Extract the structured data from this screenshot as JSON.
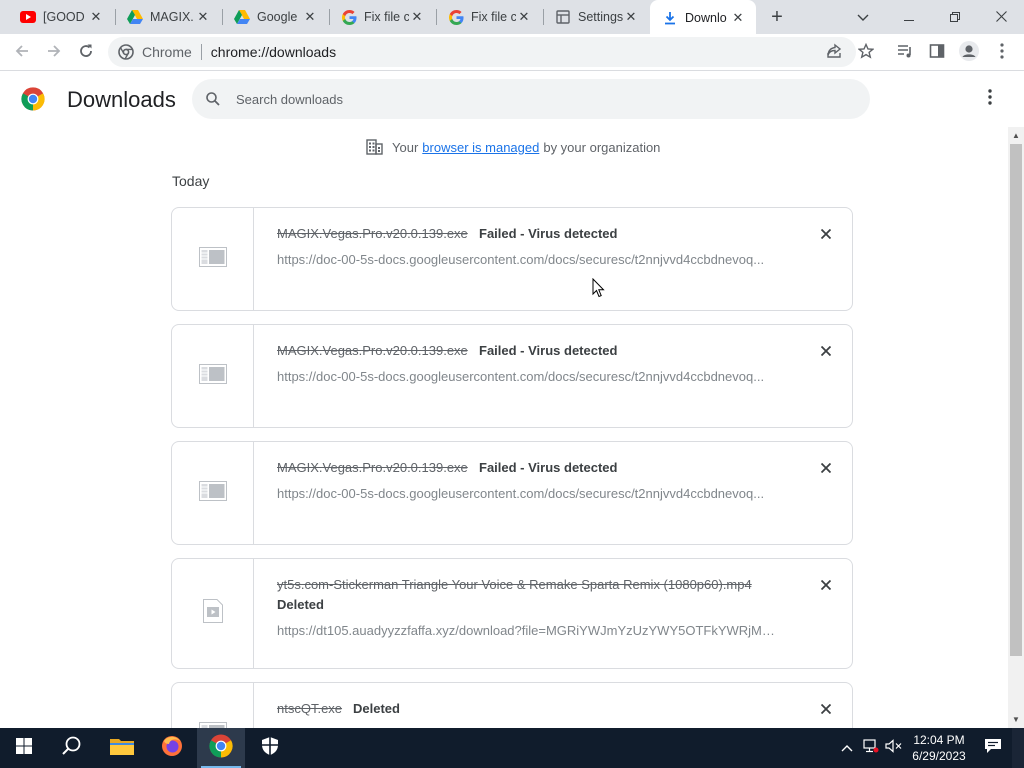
{
  "tabs": [
    {
      "title": "[GOOD",
      "favicon": "youtube-icon",
      "active": false
    },
    {
      "title": "MAGIX.",
      "favicon": "google-drive-icon",
      "active": false
    },
    {
      "title": "Google",
      "favicon": "google-drive-icon",
      "active": false
    },
    {
      "title": "Fix file c",
      "favicon": "google-icon",
      "active": false
    },
    {
      "title": "Fix file c",
      "favicon": "google-icon",
      "active": false
    },
    {
      "title": "Settings",
      "favicon": "settings-icon",
      "active": false
    },
    {
      "title": "Downlo",
      "favicon": "download-icon",
      "active": true
    }
  ],
  "toolbar": {
    "site_label": "Chrome",
    "url": "chrome://downloads"
  },
  "page": {
    "title": "Downloads",
    "search_placeholder": "Search downloads",
    "managed_prefix": "Your",
    "managed_link": "browser is managed",
    "managed_suffix": "by your organization",
    "section": "Today"
  },
  "downloads": [
    {
      "filename": "MAGIX.Vegas.Pro.v20.0.139.exe",
      "status": "Failed - Virus detected",
      "source": "https://doc-00-5s-docs.googleusercontent.com/docs/securesc/t2nnjvvd4ccbdnevoq...",
      "icon": "file-icon"
    },
    {
      "filename": "MAGIX.Vegas.Pro.v20.0.139.exe",
      "status": "Failed - Virus detected",
      "source": "https://doc-00-5s-docs.googleusercontent.com/docs/securesc/t2nnjvvd4ccbdnevoq...",
      "icon": "file-icon"
    },
    {
      "filename": "MAGIX.Vegas.Pro.v20.0.139.exe",
      "status": "Failed - Virus detected",
      "source": "https://doc-00-5s-docs.googleusercontent.com/docs/securesc/t2nnjvvd4ccbdnevoq...",
      "icon": "file-icon"
    },
    {
      "filename": "yt5s.com-Stickerman Triangle Your Voice & Remake Sparta Remix (1080p60).mp4",
      "status": "Deleted",
      "source": "https://dt105.auadyyzzfaffa.xyz/download?file=MGRiYWJmYzUzYWY5OTFkYWRjMjI...",
      "icon": "video-file-icon"
    },
    {
      "filename": "ntscQT.exe",
      "status": "Deleted",
      "source": "",
      "icon": "file-icon"
    }
  ],
  "taskbar": {
    "time": "12:04 PM",
    "date": "6/29/2023"
  },
  "colors": {
    "tabstrip": "#dee1e6",
    "accent_link": "#1a73e8",
    "taskbar": "#101c2c"
  }
}
